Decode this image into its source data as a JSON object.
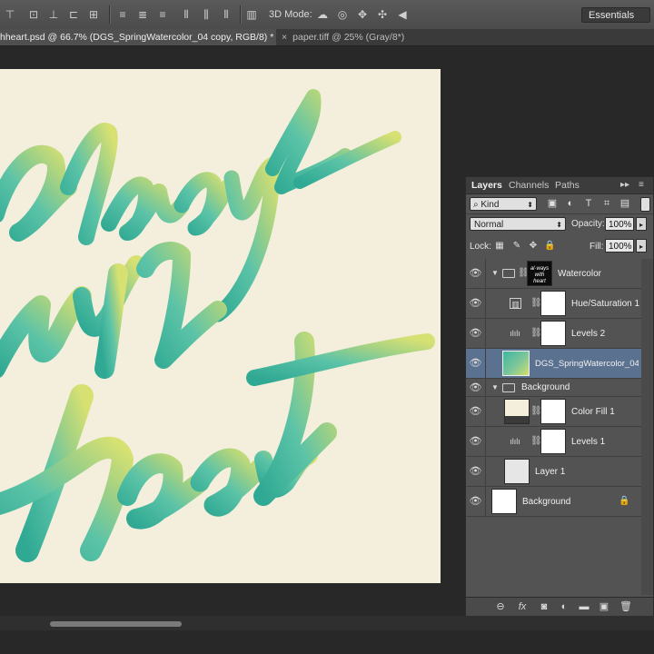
{
  "options_bar": {
    "mode3d_label": "3D Mode:",
    "workspace_label": "Essentials",
    "icons": [
      "align-top-icon",
      "align-vcenter-icon",
      "align-bottom-icon",
      "align-left-icon",
      "align-hcenter-icon",
      "align-right-icon",
      "distribute-top-icon",
      "distribute-vcenter-icon",
      "distribute-bottom-icon",
      "distribute-left-icon",
      "distribute-hcenter-icon",
      "distribute-right-icon",
      "auto-align-icon",
      "3d-rotate-icon",
      "3d-roll-icon",
      "3d-pan-icon",
      "3d-slide-icon",
      "3d-scale-icon"
    ]
  },
  "document_tabs": [
    {
      "label": "hheart.psd @ 66.7% (DGS_SpringWatercolor_04 copy, RGB/8) *",
      "active": true
    },
    {
      "label": "paper.tiff @ 25% (Gray/8*)",
      "active": false
    }
  ],
  "canvas": {
    "artwork_text": [
      "always",
      "with",
      "heart"
    ],
    "paper_color": "#f3efdc"
  },
  "layers_panel": {
    "tabs": [
      "Layers",
      "Channels",
      "Paths"
    ],
    "kind_label": "Kind",
    "blend_mode": "Normal",
    "opacity_label": "Opacity:",
    "opacity_value": "100%",
    "lock_label": "Lock:",
    "fill_label": "Fill:",
    "fill_value": "100%",
    "layers": [
      {
        "name": "Watercolor",
        "type": "group",
        "thumbnail": "watercolor-thumb"
      },
      {
        "name": "Hue/Saturation 1",
        "type": "adjustment"
      },
      {
        "name": "Levels 2",
        "type": "adjustment"
      },
      {
        "name": "DGS_SpringWatercolor_04 ...",
        "type": "pixel",
        "selected": true
      },
      {
        "name": "Background",
        "type": "group"
      },
      {
        "name": "Color Fill 1",
        "type": "fill"
      },
      {
        "name": "Levels 1",
        "type": "adjustment"
      },
      {
        "name": "Layer 1",
        "type": "pixel"
      },
      {
        "name": "Background",
        "type": "background",
        "locked": true
      }
    ],
    "bottom_icons": [
      "link-icon",
      "fx-icon",
      "mask-icon",
      "adjustment-icon",
      "new-group-icon",
      "new-layer-icon",
      "trash-icon"
    ]
  },
  "colors": {
    "selection": "#5b7190",
    "panel_bg": "#535353",
    "teal": "#3db7a0",
    "lime": "#c9dc6a"
  }
}
